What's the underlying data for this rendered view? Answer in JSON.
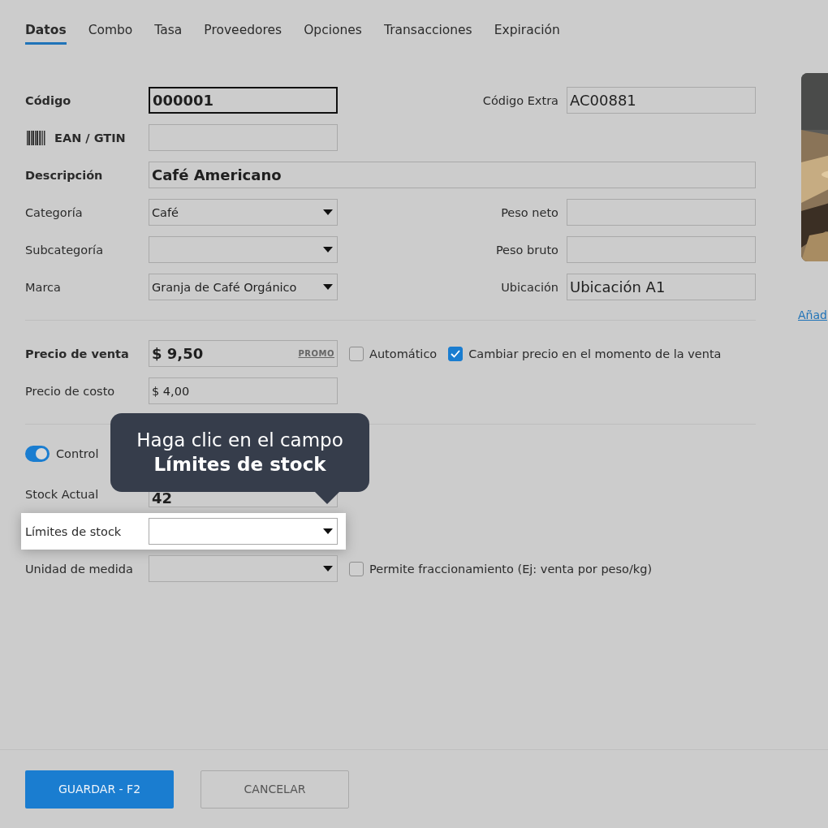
{
  "tabs": [
    {
      "label": "Datos",
      "selected": true
    },
    {
      "label": "Combo",
      "selected": false
    },
    {
      "label": "Tasa",
      "selected": false
    },
    {
      "label": "Proveedores",
      "selected": false
    },
    {
      "label": "Opciones",
      "selected": false
    },
    {
      "label": "Transacciones",
      "selected": false
    },
    {
      "label": "Expiración",
      "selected": false
    }
  ],
  "general": {
    "rows": [
      {
        "left": {
          "kind": "text",
          "label": "Código",
          "bold": true,
          "value": "000001",
          "focused": true
        },
        "right": {
          "label": "Código Extra",
          "value": "AC00881"
        }
      },
      {
        "left": {
          "kind": "barcode",
          "label": "EAN / GTIN",
          "bold": true,
          "focused": false
        }
      },
      {
        "left": {
          "kind": "wide",
          "label": "Descripción",
          "bold": true,
          "value": "Café Americano",
          "focused": false
        }
      },
      {
        "left": {
          "kind": "select",
          "label": "Categoría",
          "bold": false,
          "value": "Café",
          "focused": false
        },
        "right": {
          "label": "Peso neto"
        }
      },
      {
        "left": {
          "kind": "select",
          "label": "Subcategoría",
          "bold": false,
          "focused": false
        },
        "right": {
          "label": "Peso bruto"
        }
      },
      {
        "left": {
          "kind": "select",
          "label": "Marca",
          "bold": false,
          "value": "Granja de Café Orgánico",
          "focused": false
        },
        "right": {
          "label": "Ubicación",
          "value": "Ubicación A1"
        }
      }
    ]
  },
  "price": {
    "sale": {
      "label": "Precio de venta",
      "value": "$ 9,50",
      "badge": "PROMO"
    },
    "options": [
      {
        "label": "Automático",
        "checked": false
      },
      {
        "label": "Cambiar precio en el momento de la venta",
        "checked": true
      }
    ],
    "cost": {
      "label": "Precio de costo",
      "value": "$ 4,00"
    }
  },
  "stock": {
    "toggle": {
      "label": "Control",
      "on": true
    },
    "rows": [
      {
        "kind": "text",
        "label": "Stock Actual",
        "value": "42",
        "highlighted": false
      },
      {
        "kind": "select",
        "label": "Límites de stock",
        "highlighted": true
      },
      {
        "kind": "select",
        "label": "Unidad de medida",
        "highlighted": false,
        "option": {
          "label": "Permite fraccionamiento (Ej: venta por peso/kg)",
          "checked": false
        }
      }
    ]
  },
  "tooltip": {
    "text": "Haga clic en el campo **Límites de stock**"
  },
  "image_panel": {
    "link": "Añad"
  },
  "buttons": [
    {
      "label": "GUARDAR - F2",
      "kind": "primary"
    },
    {
      "label": "CANCELAR",
      "kind": "secondary"
    }
  ]
}
